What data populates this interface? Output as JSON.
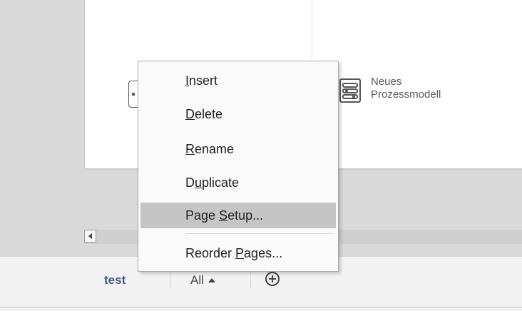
{
  "canvas": {
    "shape_label_line1": "Neues",
    "shape_label_line2": "Prozessmodell"
  },
  "page_tabs": {
    "active_tab": "test",
    "all_tab": "All",
    "add_page_icon": "plus-circle-icon"
  },
  "context_menu": {
    "items": [
      {
        "pre": "",
        "key": "I",
        "post": "nsert"
      },
      {
        "pre": "",
        "key": "D",
        "post": "elete"
      },
      {
        "pre": "",
        "key": "R",
        "post": "ename"
      },
      {
        "pre": "D",
        "key": "u",
        "post": "plicate"
      },
      {
        "pre": "Page ",
        "key": "S",
        "post": "etup..."
      },
      {
        "pre": "Reorder ",
        "key": "P",
        "post": "ages..."
      }
    ],
    "highlighted_item": "Page Setup..."
  },
  "colors": {
    "workspace": "#d9d9d9",
    "menu_highlight": "#c5c5c5",
    "active_tab_text": "#3e5c8a"
  }
}
